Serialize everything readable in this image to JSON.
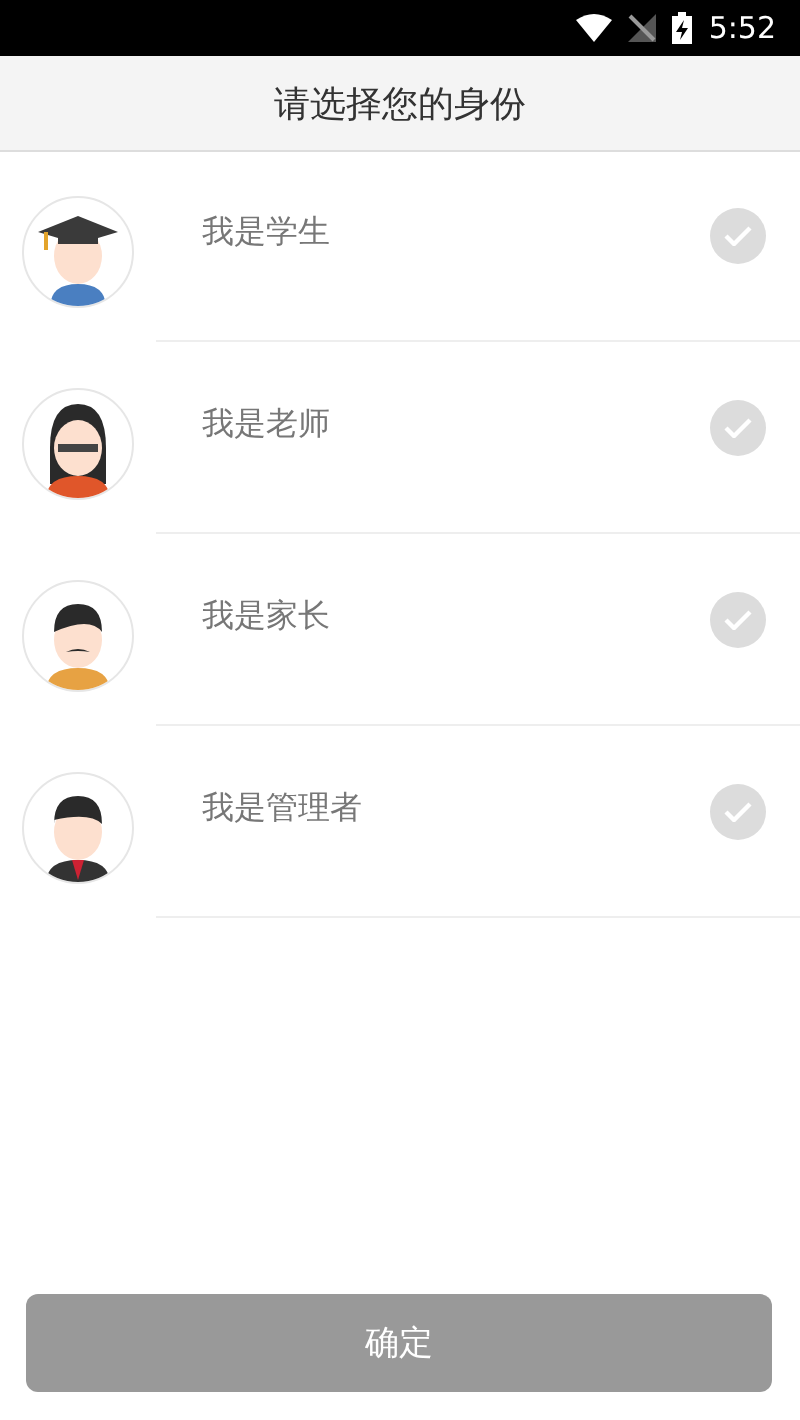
{
  "status_bar": {
    "time": "5:52"
  },
  "header": {
    "title": "请选择您的身份"
  },
  "roles": [
    {
      "label": "我是学生",
      "kind": "student",
      "selected": false
    },
    {
      "label": "我是老师",
      "kind": "teacher",
      "selected": false
    },
    {
      "label": "我是家长",
      "kind": "parent",
      "selected": false
    },
    {
      "label": "我是管理者",
      "kind": "admin",
      "selected": false
    }
  ],
  "confirm_button": {
    "label": "确定",
    "disabled": true
  }
}
